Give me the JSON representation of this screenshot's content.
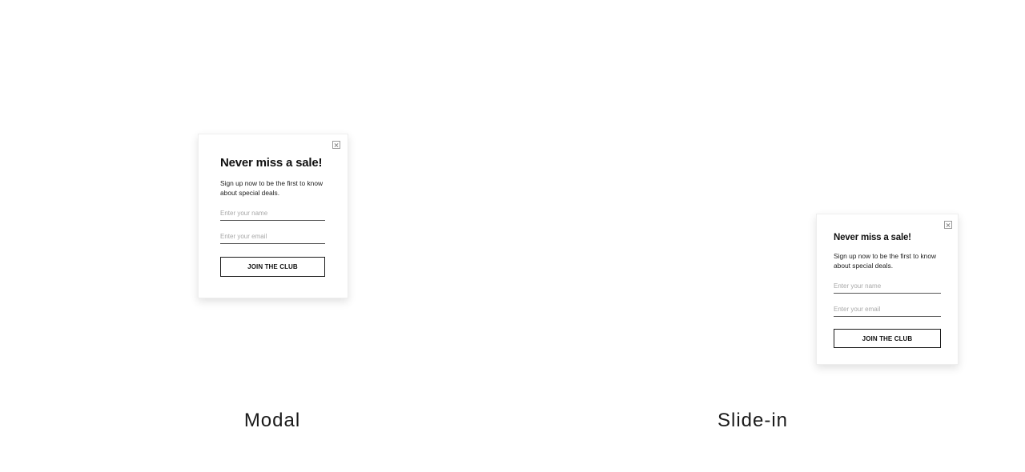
{
  "modal": {
    "headline": "Never miss a sale!",
    "body": "Sign up now to be the first to know about special deals.",
    "name_placeholder": "Enter your name",
    "email_placeholder": "Enter your email",
    "cta_label": "JOIN THE CLUB",
    "close_icon": "close-icon"
  },
  "slide_in": {
    "headline": "Never miss a sale!",
    "body": "Sign up now to be the first to know about special deals.",
    "name_placeholder": "Enter your name",
    "email_placeholder": "Enter your email",
    "cta_label": "JOIN THE CLUB",
    "close_icon": "close-icon"
  },
  "captions": {
    "modal": "Modal",
    "slide_in": "Slide-in"
  }
}
